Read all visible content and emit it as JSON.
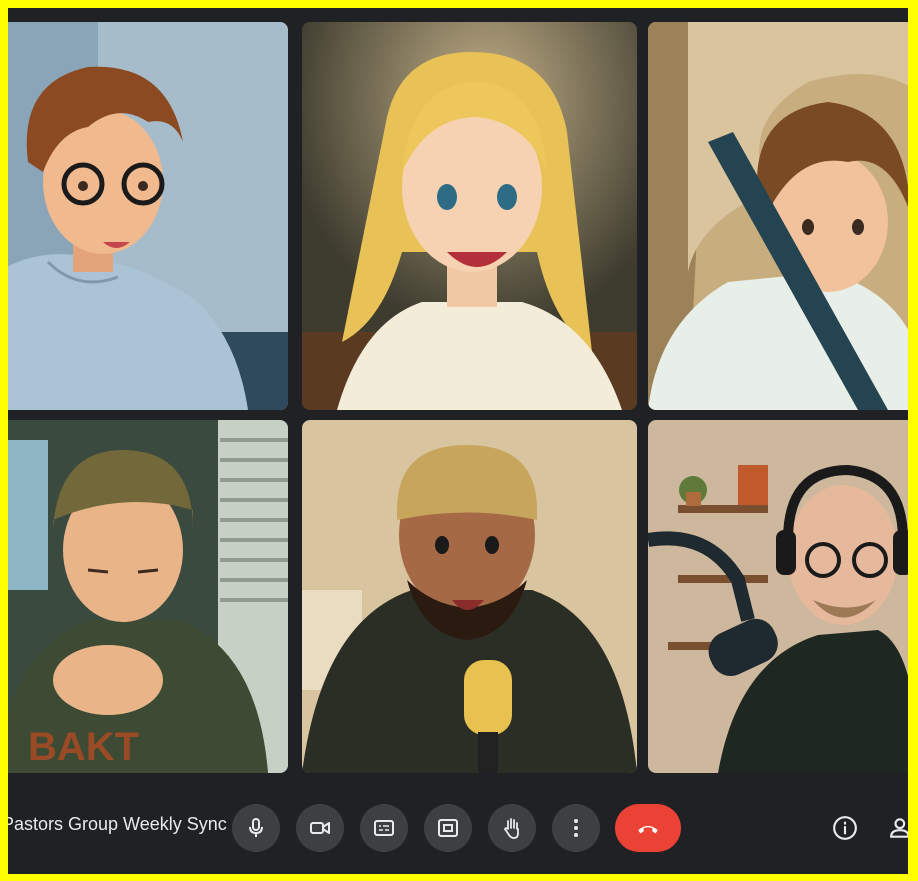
{
  "meeting": {
    "title": "Pastors Group Weekly Sync"
  },
  "controls": [
    {
      "name": "microphone",
      "icon": "microphone-icon"
    },
    {
      "name": "camera",
      "icon": "video-camera-icon"
    },
    {
      "name": "captions",
      "icon": "closed-captions-icon"
    },
    {
      "name": "present",
      "icon": "present-screen-icon"
    },
    {
      "name": "raise-hand",
      "icon": "raise-hand-icon"
    },
    {
      "name": "more-options",
      "icon": "more-vertical-icon"
    },
    {
      "name": "leave-call",
      "icon": "end-call-icon"
    }
  ],
  "right_controls": [
    {
      "name": "meeting-info",
      "icon": "info-icon"
    },
    {
      "name": "people",
      "icon": "people-icon"
    }
  ],
  "participants": [
    {
      "icon": "participant-glasses-boy-video"
    },
    {
      "icon": "participant-blonde-woman-video"
    },
    {
      "icon": "participant-car-boy-video"
    },
    {
      "icon": "participant-cap-man-video"
    },
    {
      "icon": "participant-beanie-man-video"
    },
    {
      "icon": "participant-headphones-man-video"
    }
  ],
  "colors": {
    "background": "#202124",
    "control_button": "#3c4043",
    "end_call": "#ea4335",
    "text": "#e8eaed",
    "border": "#ffff00"
  }
}
